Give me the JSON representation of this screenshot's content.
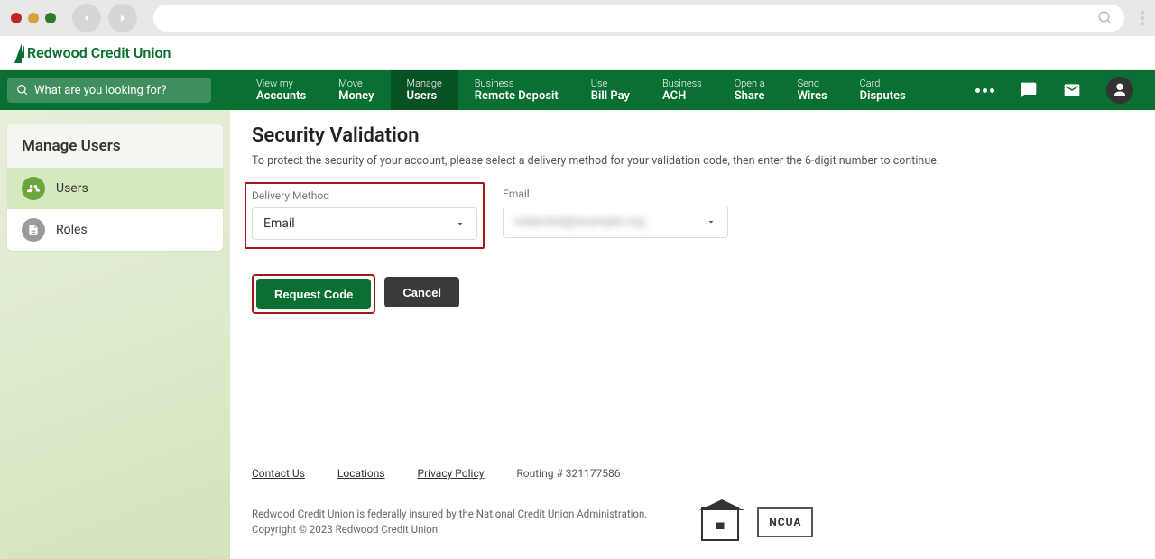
{
  "browser": {
    "search_icon": "search"
  },
  "brand": {
    "name": "Redwood Credit Union"
  },
  "nav": {
    "search_placeholder": "What are you looking for?",
    "items": [
      {
        "line1": "View my",
        "line2": "Accounts"
      },
      {
        "line1": "Move",
        "line2": "Money"
      },
      {
        "line1": "Manage",
        "line2": "Users"
      },
      {
        "line1": "Business",
        "line2": "Remote Deposit"
      },
      {
        "line1": "Use",
        "line2": "Bill Pay"
      },
      {
        "line1": "Business",
        "line2": "ACH"
      },
      {
        "line1": "Open a",
        "line2": "Share"
      },
      {
        "line1": "Send",
        "line2": "Wires"
      },
      {
        "line1": "Card",
        "line2": "Disputes"
      }
    ]
  },
  "sidebar": {
    "title": "Manage Users",
    "items": [
      {
        "label": "Users"
      },
      {
        "label": "Roles"
      }
    ]
  },
  "page": {
    "title": "Security Validation",
    "description": "To protect the security of your account, please select a delivery method for your validation code, then enter the 6-digit number to continue."
  },
  "form": {
    "delivery_label": "Delivery Method",
    "delivery_value": "Email",
    "email_label": "Email",
    "email_value": "redacted@example.org",
    "request_label": "Request Code",
    "cancel_label": "Cancel"
  },
  "footer": {
    "links": [
      "Contact Us",
      "Locations",
      "Privacy Policy"
    ],
    "routing": "Routing # 321177586",
    "disclosure": "Redwood Credit Union is federally insured by the National Credit Union Administration.",
    "copyright": "Copyright © 2023 Redwood Credit Union.",
    "ncua": "NCUA"
  }
}
